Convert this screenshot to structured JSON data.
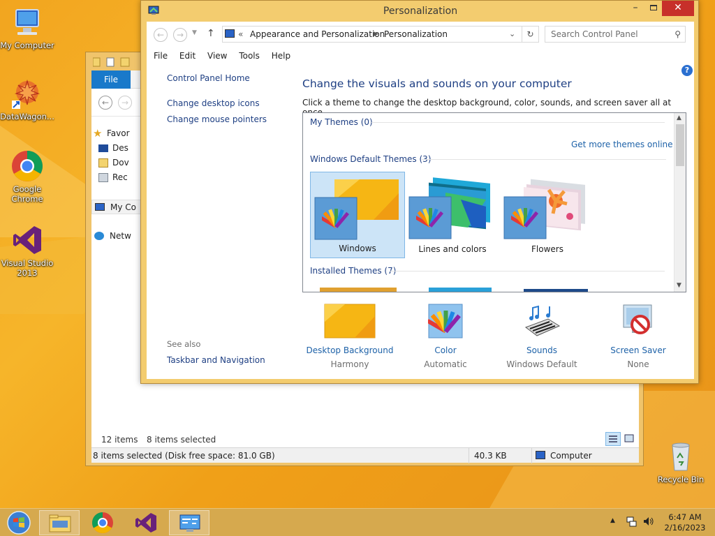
{
  "desktop": {
    "icons": [
      {
        "label": "My Computer"
      },
      {
        "label": "DataWagon..."
      },
      {
        "label": "Google Chrome"
      },
      {
        "label": "Visual Studio 2013"
      },
      {
        "label": "Recycle Bin"
      }
    ]
  },
  "explorer": {
    "file_tab": "File",
    "tree": [
      "Favor",
      "Des",
      "Dov",
      "Rec",
      "My Co",
      "Netw"
    ],
    "items_count": "12 items",
    "items_selected": "8 items selected",
    "status_left": "8 items selected (Disk free space: 81.0 GB)",
    "status_size": "40.3 KB",
    "status_location": "Computer"
  },
  "personalization": {
    "title": "Personalization",
    "breadcrumb": [
      "Appearance and Personalization",
      "Personalization"
    ],
    "breadcrumb_prefix": "«",
    "search_placeholder": "Search Control Panel",
    "menu": [
      "File",
      "Edit",
      "View",
      "Tools",
      "Help"
    ],
    "left_home": "Control Panel Home",
    "left_links": [
      "Change desktop icons",
      "Change mouse pointers"
    ],
    "see_also": "See also",
    "see_also_links": [
      "Taskbar and Navigation"
    ],
    "heading": "Change the visuals and sounds on your computer",
    "subheading": "Click a theme to change the desktop background, color, sounds, and screen saver all at once.",
    "my_themes": "My Themes (0)",
    "get_more": "Get more themes online",
    "default_themes": "Windows Default Themes (3)",
    "themes": [
      {
        "name": "Windows",
        "selected": true
      },
      {
        "name": "Lines and colors",
        "selected": false
      },
      {
        "name": "Flowers",
        "selected": false
      }
    ],
    "installed_themes": "Installed Themes (7)",
    "bottom": [
      {
        "title": "Desktop Background",
        "value": "Harmony"
      },
      {
        "title": "Color",
        "value": "Automatic"
      },
      {
        "title": "Sounds",
        "value": "Windows Default"
      },
      {
        "title": "Screen Saver",
        "value": "None"
      }
    ]
  },
  "taskbar": {
    "time": "6:47 AM",
    "date": "2/16/2023"
  },
  "colors": {
    "accent": "#1979ca",
    "link": "#1e3f83",
    "close": "#c7302a"
  }
}
